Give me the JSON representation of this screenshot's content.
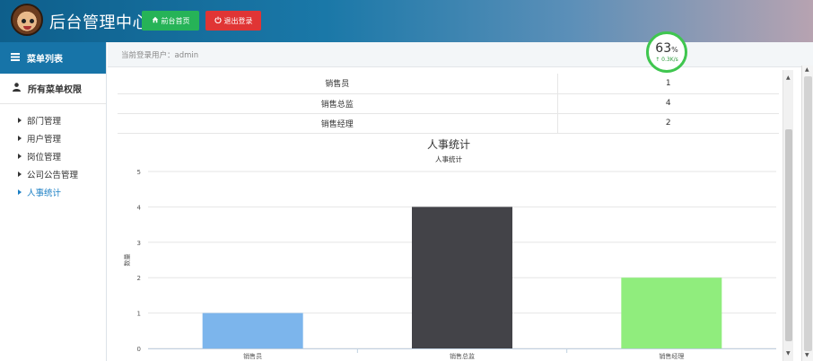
{
  "header": {
    "title": "后台管理中心",
    "home_button": "前台首页",
    "logout_button": "退出登录",
    "home_icon": "home-icon",
    "logout_icon": "power-icon"
  },
  "sidebar": {
    "menu_title": "菜单列表",
    "permission_title": "所有菜单权限",
    "items": [
      {
        "label": "部门管理"
      },
      {
        "label": "用户管理"
      },
      {
        "label": "岗位管理"
      },
      {
        "label": "公司公告管理"
      },
      {
        "label": "人事统计",
        "active": true
      }
    ]
  },
  "breadcrumb": {
    "text": "当前登录用户：admin"
  },
  "gauge": {
    "percent": "63",
    "unit": "%",
    "rate": "↑ 0.3K/s"
  },
  "table": {
    "rows": [
      {
        "role": "销售员",
        "count": "1"
      },
      {
        "role": "销售总监",
        "count": "4"
      },
      {
        "role": "销售经理",
        "count": "2"
      }
    ]
  },
  "chart_data": {
    "type": "bar",
    "title": "人事统计",
    "subtitle": "人事统计",
    "ylabel": "数量",
    "categories": [
      "销售员",
      "销售总监",
      "销售经理"
    ],
    "values": [
      1,
      4,
      2
    ],
    "colors": [
      "#7cb5ec",
      "#434348",
      "#90ed7d"
    ],
    "ylim": [
      0,
      5
    ],
    "yticks": [
      "0",
      "1",
      "2",
      "3",
      "4",
      "5"
    ],
    "grid": true
  },
  "colors": {
    "accent": "#1774a8",
    "home_button": "#26b357",
    "logout_button": "#e03535",
    "active_item": "#1b7fc4"
  }
}
